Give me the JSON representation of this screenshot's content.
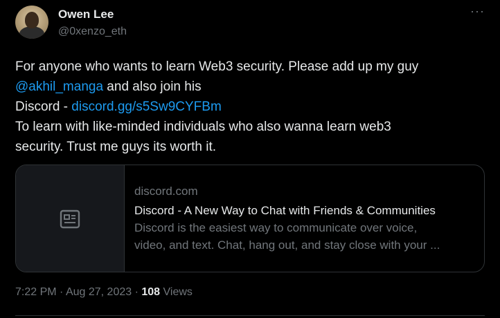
{
  "author": {
    "name": "Owen Lee",
    "handle": "@0xenzo_eth"
  },
  "tweet": {
    "line1": "For anyone who wants to learn Web3 security. Please add up my guy",
    "mention": "@akhil_manga",
    "line2_rest": " and also join his",
    "discord_prefix": "Discord - ",
    "discord_link": "discord.gg/s5Sw9CYFBm",
    "line4": "To learn with like-minded individuals who also wanna learn web3",
    "line5": "security. Trust me guys its worth it."
  },
  "card": {
    "domain": "discord.com",
    "title": "Discord - A New Way to Chat with Friends & Communities",
    "description_line1": "Discord is the easiest way to communicate over voice,",
    "description_line2": "video, and text. Chat, hang out, and stay close with your ...",
    "thumbnail_icon": "article-icon"
  },
  "meta": {
    "time": "7:22 PM",
    "date": "Aug 27, 2023",
    "separator": " · ",
    "views_count": "108",
    "views_label": "Views"
  },
  "more_label": "···",
  "colors": {
    "link": "#1d9bf0",
    "background": "#000000",
    "muted": "#71767b"
  }
}
